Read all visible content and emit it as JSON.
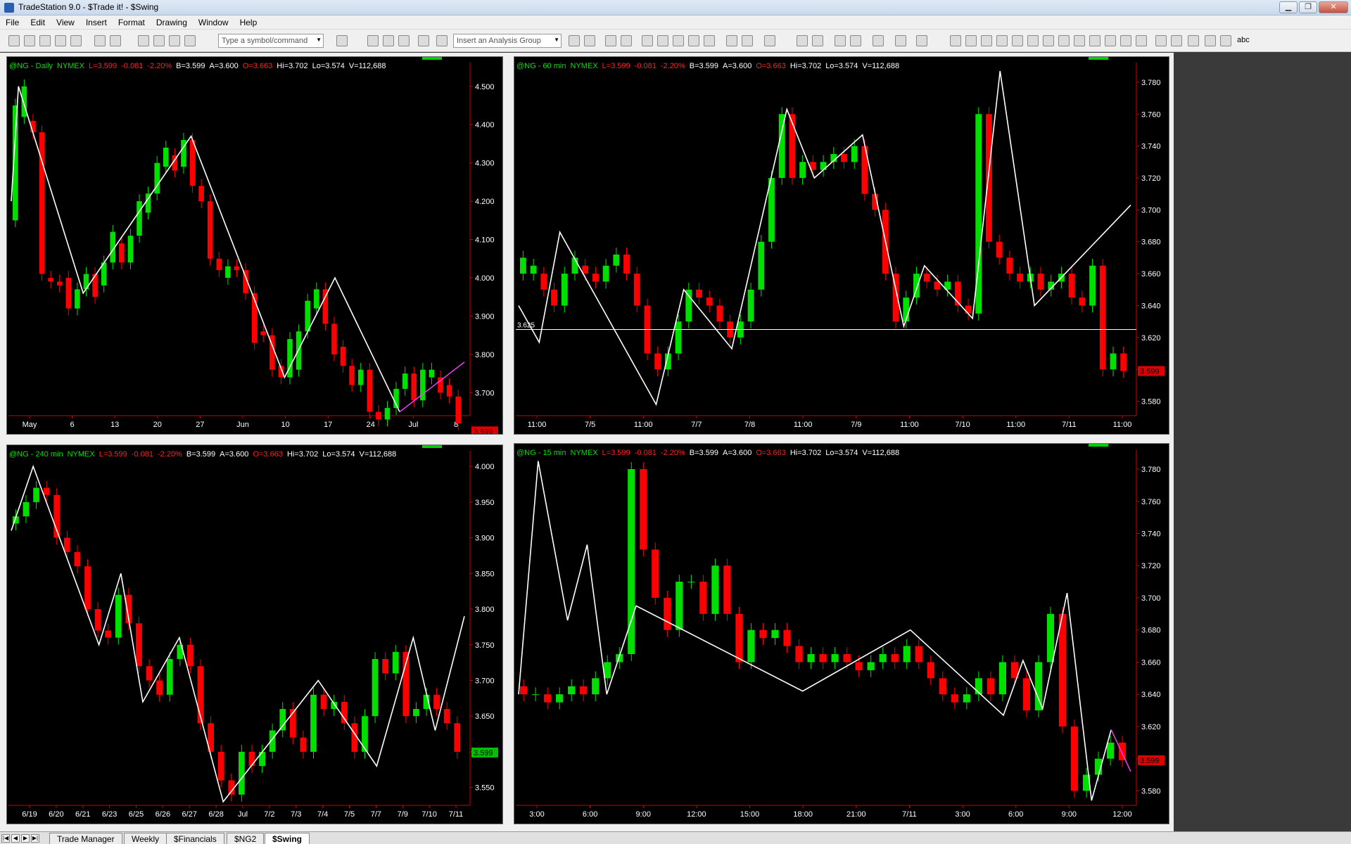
{
  "window": {
    "title": "TradeStation 9.0 - $Trade it! - $Swing",
    "min": "▁",
    "max": "❐",
    "close": "✕"
  },
  "menu": [
    "File",
    "Edit",
    "View",
    "Insert",
    "Format",
    "Drawing",
    "Window",
    "Help"
  ],
  "toolbar": {
    "symbol_placeholder": "Type a symbol/command",
    "analysis_placeholder": "Insert an Analysis Group",
    "draw_text": "abc"
  },
  "quote": {
    "last": "L=3.599",
    "change": "-0.081",
    "pct": "-2.20%",
    "bid": "B=3.599",
    "ask": "A=3.600",
    "open": "O=3.663",
    "high": "Hi=3.702",
    "low": "Lo=3.574",
    "volume": "V=112,688"
  },
  "charts": [
    {
      "id": "daily",
      "symbol": "@NG - Daily",
      "exchange": "NYMEX",
      "y_ticks": [
        "4.500",
        "4.400",
        "4.300",
        "4.200",
        "4.100",
        "4.000",
        "3.900",
        "3.800",
        "3.700"
      ],
      "ymin": 3.64,
      "ymax": 4.54,
      "price_label": "3.599",
      "x_labels": [
        "May",
        "6",
        "13",
        "20",
        "27",
        "Jun",
        "10",
        "17",
        "24",
        "Jul",
        "8"
      ],
      "bars": [
        [
          4.15,
          4.45
        ],
        [
          4.42,
          4.5
        ],
        [
          4.41,
          4.38
        ],
        [
          4.38,
          4.01
        ],
        [
          4.0,
          3.99
        ],
        [
          3.99,
          3.98
        ],
        [
          4.0,
          3.92
        ],
        [
          3.92,
          3.97
        ],
        [
          3.97,
          4.01
        ],
        [
          4.01,
          3.95
        ],
        [
          3.98,
          4.04
        ],
        [
          4.04,
          4.12
        ],
        [
          4.09,
          4.04
        ],
        [
          4.04,
          4.11
        ],
        [
          4.11,
          4.2
        ],
        [
          4.17,
          4.22
        ],
        [
          4.22,
          4.3
        ],
        [
          4.29,
          4.34
        ],
        [
          4.32,
          4.28
        ],
        [
          4.29,
          4.36
        ],
        [
          4.36,
          4.24
        ],
        [
          4.24,
          4.2
        ],
        [
          4.2,
          4.05
        ],
        [
          4.05,
          4.02
        ],
        [
          4.0,
          4.03
        ],
        [
          4.03,
          4.02
        ],
        [
          4.02,
          3.96
        ],
        [
          3.96,
          3.83
        ],
        [
          3.86,
          3.85
        ],
        [
          3.85,
          3.76
        ],
        [
          3.77,
          3.74
        ],
        [
          3.74,
          3.84
        ],
        [
          3.76,
          3.86
        ],
        [
          3.86,
          3.94
        ],
        [
          3.92,
          3.97
        ],
        [
          3.97,
          3.88
        ],
        [
          3.88,
          3.8
        ],
        [
          3.82,
          3.77
        ],
        [
          3.77,
          3.72
        ],
        [
          3.72,
          3.76
        ],
        [
          3.76,
          3.65
        ],
        [
          3.65,
          3.63
        ],
        [
          3.63,
          3.66
        ],
        [
          3.66,
          3.71
        ],
        [
          3.71,
          3.75
        ],
        [
          3.75,
          3.68
        ],
        [
          3.68,
          3.76
        ],
        [
          3.74,
          3.76
        ],
        [
          3.74,
          3.7
        ],
        [
          3.72,
          3.69
        ],
        [
          3.69,
          3.62
        ]
      ],
      "swing": [
        [
          0,
          4.2
        ],
        [
          1,
          4.5
        ],
        [
          10,
          3.96
        ],
        [
          25,
          4.37
        ],
        [
          38,
          3.74
        ],
        [
          45,
          4.0
        ],
        [
          54,
          3.65
        ]
      ],
      "swing2": [
        [
          54,
          3.65
        ],
        [
          63,
          3.78
        ]
      ]
    },
    {
      "id": "60min",
      "symbol": "@NG - 60 min",
      "exchange": "NYMEX",
      "y_ticks": [
        "3.780",
        "3.760",
        "3.740",
        "3.720",
        "3.700",
        "3.680",
        "3.660",
        "3.640",
        "3.620",
        "3.600",
        "3.580"
      ],
      "ymin": 3.571,
      "ymax": 3.787,
      "hline": 3.625,
      "hline_label": "3.625",
      "price_label": "3.599",
      "x_labels": [
        "11:00",
        "7/5",
        "11:00",
        "7/7",
        "7/8",
        "11:00",
        "7/9",
        "11:00",
        "7/10",
        "11:00",
        "7/11",
        "11:00"
      ],
      "bars": [
        [
          3.66,
          3.67
        ],
        [
          3.66,
          3.665
        ],
        [
          3.66,
          3.65
        ],
        [
          3.65,
          3.64
        ],
        [
          3.64,
          3.66
        ],
        [
          3.66,
          3.67
        ],
        [
          3.665,
          3.66
        ],
        [
          3.66,
          3.655
        ],
        [
          3.655,
          3.665
        ],
        [
          3.665,
          3.672
        ],
        [
          3.672,
          3.66
        ],
        [
          3.66,
          3.64
        ],
        [
          3.64,
          3.61
        ],
        [
          3.61,
          3.6
        ],
        [
          3.6,
          3.61
        ],
        [
          3.61,
          3.63
        ],
        [
          3.63,
          3.65
        ],
        [
          3.65,
          3.645
        ],
        [
          3.645,
          3.64
        ],
        [
          3.64,
          3.63
        ],
        [
          3.63,
          3.62
        ],
        [
          3.62,
          3.63
        ],
        [
          3.63,
          3.65
        ],
        [
          3.65,
          3.68
        ],
        [
          3.68,
          3.72
        ],
        [
          3.72,
          3.76
        ],
        [
          3.76,
          3.72
        ],
        [
          3.72,
          3.73
        ],
        [
          3.73,
          3.725
        ],
        [
          3.725,
          3.73
        ],
        [
          3.73,
          3.735
        ],
        [
          3.735,
          3.73
        ],
        [
          3.73,
          3.74
        ],
        [
          3.74,
          3.71
        ],
        [
          3.71,
          3.7
        ],
        [
          3.7,
          3.66
        ],
        [
          3.66,
          3.63
        ],
        [
          3.63,
          3.645
        ],
        [
          3.645,
          3.66
        ],
        [
          3.66,
          3.655
        ],
        [
          3.655,
          3.65
        ],
        [
          3.65,
          3.655
        ],
        [
          3.655,
          3.64
        ],
        [
          3.64,
          3.635
        ],
        [
          3.635,
          3.76
        ],
        [
          3.76,
          3.68
        ],
        [
          3.68,
          3.67
        ],
        [
          3.67,
          3.66
        ],
        [
          3.66,
          3.655
        ],
        [
          3.655,
          3.66
        ],
        [
          3.66,
          3.65
        ],
        [
          3.65,
          3.655
        ],
        [
          3.655,
          3.66
        ],
        [
          3.66,
          3.645
        ],
        [
          3.645,
          3.64
        ],
        [
          3.64,
          3.665
        ],
        [
          3.665,
          3.6
        ],
        [
          3.6,
          3.61
        ],
        [
          3.61,
          3.599
        ]
      ],
      "swing": [
        [
          0,
          3.64
        ],
        [
          3,
          3.617
        ],
        [
          6,
          3.686
        ],
        [
          20,
          3.578
        ],
        [
          24,
          3.65
        ],
        [
          31,
          3.613
        ],
        [
          39,
          3.763
        ],
        [
          43,
          3.72
        ],
        [
          50,
          3.747
        ],
        [
          56,
          3.627
        ],
        [
          59,
          3.665
        ],
        [
          66,
          3.632
        ],
        [
          70,
          3.787
        ],
        [
          75,
          3.64
        ],
        [
          89,
          3.703
        ]
      ]
    },
    {
      "id": "240min",
      "symbol": "@NG - 240 min",
      "exchange": "NYMEX",
      "y_ticks": [
        "4.000",
        "3.950",
        "3.900",
        "3.850",
        "3.800",
        "3.750",
        "3.700",
        "3.650",
        "3.600",
        "3.550"
      ],
      "ymin": 3.525,
      "ymax": 4.01,
      "price_label": "3.599",
      "x_labels": [
        "6/19",
        "6/20",
        "6/21",
        "6/23",
        "6/25",
        "6/26",
        "6/27",
        "6/28",
        "Jul",
        "7/2",
        "7/3",
        "7/4",
        "7/5",
        "7/7",
        "7/9",
        "7/10",
        "7/11"
      ],
      "bars": [
        [
          3.92,
          3.93
        ],
        [
          3.93,
          3.95
        ],
        [
          3.95,
          3.97
        ],
        [
          3.97,
          3.96
        ],
        [
          3.96,
          3.9
        ],
        [
          3.9,
          3.88
        ],
        [
          3.88,
          3.86
        ],
        [
          3.86,
          3.8
        ],
        [
          3.8,
          3.77
        ],
        [
          3.77,
          3.76
        ],
        [
          3.76,
          3.82
        ],
        [
          3.82,
          3.78
        ],
        [
          3.78,
          3.72
        ],
        [
          3.72,
          3.7
        ],
        [
          3.7,
          3.68
        ],
        [
          3.68,
          3.73
        ],
        [
          3.73,
          3.75
        ],
        [
          3.75,
          3.72
        ],
        [
          3.72,
          3.64
        ],
        [
          3.64,
          3.6
        ],
        [
          3.6,
          3.56
        ],
        [
          3.56,
          3.54
        ],
        [
          3.54,
          3.6
        ],
        [
          3.6,
          3.58
        ],
        [
          3.58,
          3.6
        ],
        [
          3.6,
          3.63
        ],
        [
          3.63,
          3.66
        ],
        [
          3.66,
          3.62
        ],
        [
          3.62,
          3.6
        ],
        [
          3.6,
          3.68
        ],
        [
          3.68,
          3.66
        ],
        [
          3.66,
          3.67
        ],
        [
          3.67,
          3.64
        ],
        [
          3.64,
          3.6
        ],
        [
          3.6,
          3.65
        ],
        [
          3.65,
          3.73
        ],
        [
          3.73,
          3.71
        ],
        [
          3.71,
          3.74
        ],
        [
          3.74,
          3.65
        ],
        [
          3.65,
          3.66
        ],
        [
          3.66,
          3.68
        ],
        [
          3.68,
          3.66
        ],
        [
          3.66,
          3.64
        ],
        [
          3.64,
          3.6
        ]
      ],
      "swing": [
        [
          0,
          3.91
        ],
        [
          3,
          4.0
        ],
        [
          12,
          3.75
        ],
        [
          15,
          3.85
        ],
        [
          18,
          3.67
        ],
        [
          23,
          3.76
        ],
        [
          29,
          3.53
        ],
        [
          42,
          3.7
        ],
        [
          50,
          3.58
        ],
        [
          55,
          3.76
        ],
        [
          58,
          3.63
        ],
        [
          62,
          3.79
        ]
      ]
    },
    {
      "id": "15min",
      "symbol": "@NG - 15 min",
      "exchange": "NYMEX",
      "y_ticks": [
        "3.780",
        "3.760",
        "3.740",
        "3.720",
        "3.700",
        "3.680",
        "3.660",
        "3.640",
        "3.620",
        "3.600",
        "3.580"
      ],
      "ymin": 3.571,
      "ymax": 3.787,
      "price_label": "3.599",
      "x_labels": [
        "3:00",
        "6:00",
        "9:00",
        "12:00",
        "15:00",
        "18:00",
        "21:00",
        "7/11",
        "3:00",
        "6:00",
        "9:00",
        "12:00"
      ],
      "bars": [
        [
          3.645,
          3.64
        ],
        [
          3.64,
          3.64
        ],
        [
          3.64,
          3.635
        ],
        [
          3.635,
          3.64
        ],
        [
          3.64,
          3.645
        ],
        [
          3.645,
          3.64
        ],
        [
          3.64,
          3.65
        ],
        [
          3.65,
          3.66
        ],
        [
          3.66,
          3.665
        ],
        [
          3.665,
          3.78
        ],
        [
          3.78,
          3.73
        ],
        [
          3.73,
          3.7
        ],
        [
          3.7,
          3.68
        ],
        [
          3.68,
          3.71
        ],
        [
          3.71,
          3.71
        ],
        [
          3.71,
          3.69
        ],
        [
          3.69,
          3.72
        ],
        [
          3.72,
          3.69
        ],
        [
          3.69,
          3.66
        ],
        [
          3.66,
          3.68
        ],
        [
          3.68,
          3.675
        ],
        [
          3.675,
          3.68
        ],
        [
          3.68,
          3.67
        ],
        [
          3.67,
          3.66
        ],
        [
          3.66,
          3.665
        ],
        [
          3.665,
          3.66
        ],
        [
          3.66,
          3.665
        ],
        [
          3.665,
          3.66
        ],
        [
          3.66,
          3.655
        ],
        [
          3.655,
          3.66
        ],
        [
          3.66,
          3.665
        ],
        [
          3.665,
          3.66
        ],
        [
          3.66,
          3.67
        ],
        [
          3.67,
          3.66
        ],
        [
          3.66,
          3.65
        ],
        [
          3.65,
          3.64
        ],
        [
          3.64,
          3.635
        ],
        [
          3.635,
          3.64
        ],
        [
          3.64,
          3.65
        ],
        [
          3.65,
          3.64
        ],
        [
          3.64,
          3.66
        ],
        [
          3.66,
          3.65
        ],
        [
          3.65,
          3.63
        ],
        [
          3.63,
          3.66
        ],
        [
          3.66,
          3.69
        ],
        [
          3.69,
          3.62
        ],
        [
          3.62,
          3.58
        ],
        [
          3.58,
          3.59
        ],
        [
          3.59,
          3.6
        ],
        [
          3.6,
          3.61
        ],
        [
          3.61,
          3.599
        ]
      ],
      "swing": [
        [
          0,
          3.64
        ],
        [
          4,
          3.785
        ],
        [
          10,
          3.686
        ],
        [
          14,
          3.733
        ],
        [
          18,
          3.64
        ],
        [
          24,
          3.695
        ],
        [
          58,
          3.642
        ],
        [
          80,
          3.68
        ],
        [
          99,
          3.627
        ],
        [
          103,
          3.661
        ],
        [
          107,
          3.631
        ],
        [
          112,
          3.703
        ],
        [
          117,
          3.574
        ],
        [
          121,
          3.618
        ]
      ],
      "swing2": [
        [
          121,
          3.618
        ],
        [
          125,
          3.592
        ]
      ]
    }
  ],
  "tabs": [
    "Trade Manager",
    "Weekly",
    "$Financials",
    "$NG2",
    "$Swing"
  ],
  "active_tab": "$Swing",
  "colors": {
    "up": "#00e000",
    "down": "#ff0000",
    "swing": "#ffffff",
    "swing2": "#ff40ff",
    "axis": "#cc0000"
  }
}
